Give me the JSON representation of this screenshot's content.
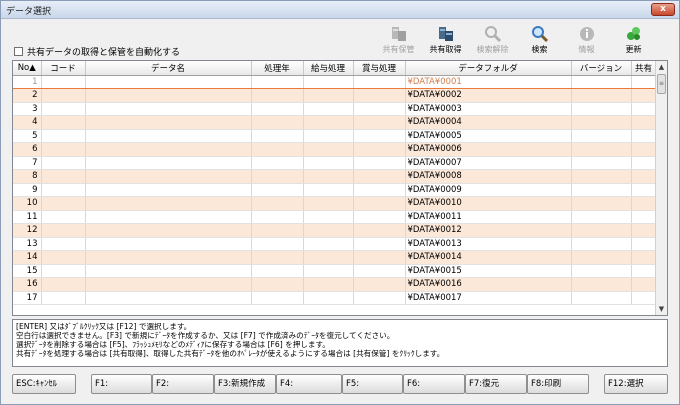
{
  "window": {
    "title": "データ選択",
    "close_label": "x"
  },
  "auto_checkbox": {
    "label": "共有データの取得と保管を自動化する",
    "checked": false
  },
  "toolbar": [
    {
      "label": "共有保管",
      "icon": "share-store-icon",
      "enabled": false
    },
    {
      "label": "共有取得",
      "icon": "share-get-icon",
      "enabled": true
    },
    {
      "label": "検索解除",
      "icon": "search-clear-icon",
      "enabled": false
    },
    {
      "label": "検索",
      "icon": "search-icon",
      "enabled": true
    },
    {
      "label": "情報",
      "icon": "info-icon",
      "enabled": false
    },
    {
      "label": "更新",
      "icon": "refresh-icon",
      "enabled": true
    }
  ],
  "grid": {
    "columns": [
      "No▲",
      "コード",
      "データ名",
      "処理年",
      "給与処理",
      "賞与処理",
      "データフォルダ",
      "バージョン",
      "共有"
    ],
    "selected_row": 1,
    "rows": [
      {
        "no": "1",
        "folder": "¥DATA¥0001"
      },
      {
        "no": "2",
        "folder": "¥DATA¥0002"
      },
      {
        "no": "3",
        "folder": "¥DATA¥0003"
      },
      {
        "no": "4",
        "folder": "¥DATA¥0004"
      },
      {
        "no": "5",
        "folder": "¥DATA¥0005"
      },
      {
        "no": "6",
        "folder": "¥DATA¥0006"
      },
      {
        "no": "7",
        "folder": "¥DATA¥0007"
      },
      {
        "no": "8",
        "folder": "¥DATA¥0008"
      },
      {
        "no": "9",
        "folder": "¥DATA¥0009"
      },
      {
        "no": "10",
        "folder": "¥DATA¥0010"
      },
      {
        "no": "11",
        "folder": "¥DATA¥0011"
      },
      {
        "no": "12",
        "folder": "¥DATA¥0012"
      },
      {
        "no": "13",
        "folder": "¥DATA¥0013"
      },
      {
        "no": "14",
        "folder": "¥DATA¥0014"
      },
      {
        "no": "15",
        "folder": "¥DATA¥0015"
      },
      {
        "no": "16",
        "folder": "¥DATA¥0016"
      },
      {
        "no": "17",
        "folder": "¥DATA¥0017"
      }
    ]
  },
  "messages": [
    "[ENTER] 又はﾀﾞﾌﾞﾙｸﾘｯｸ又は [F12] で選択します。",
    "空白行は選択できません。[F3] で新規にﾃﾞｰﾀを作成するか、又は [F7] で作成済みのﾃﾞｰﾀを復元してください。",
    "選択ﾃﾞｰﾀを削除する場合は [F5]、ﾌﾗｯｼｭﾒﾓﾘなどのﾒﾃﾞｨｱに保存する場合は [F6] を押します。",
    "共有ﾃﾞｰﾀを処理する場合は [共有取得]、取得した共有ﾃﾞｰﾀを他のｵﾍﾟﾚｰﾀが使えるようにする場合は [共有保管] をｸﾘｯｸします。"
  ],
  "fkeys": [
    {
      "label": "ESC:ｷｬﾝｾﾙ"
    },
    {
      "label": "F1:"
    },
    {
      "label": "F2:"
    },
    {
      "label": "F3:新規作成"
    },
    {
      "label": "F4:"
    },
    {
      "label": "F5:"
    },
    {
      "label": "F6:"
    },
    {
      "label": "F7:復元"
    },
    {
      "label": "F8:印刷"
    },
    {
      "label": "F12:選択"
    }
  ]
}
